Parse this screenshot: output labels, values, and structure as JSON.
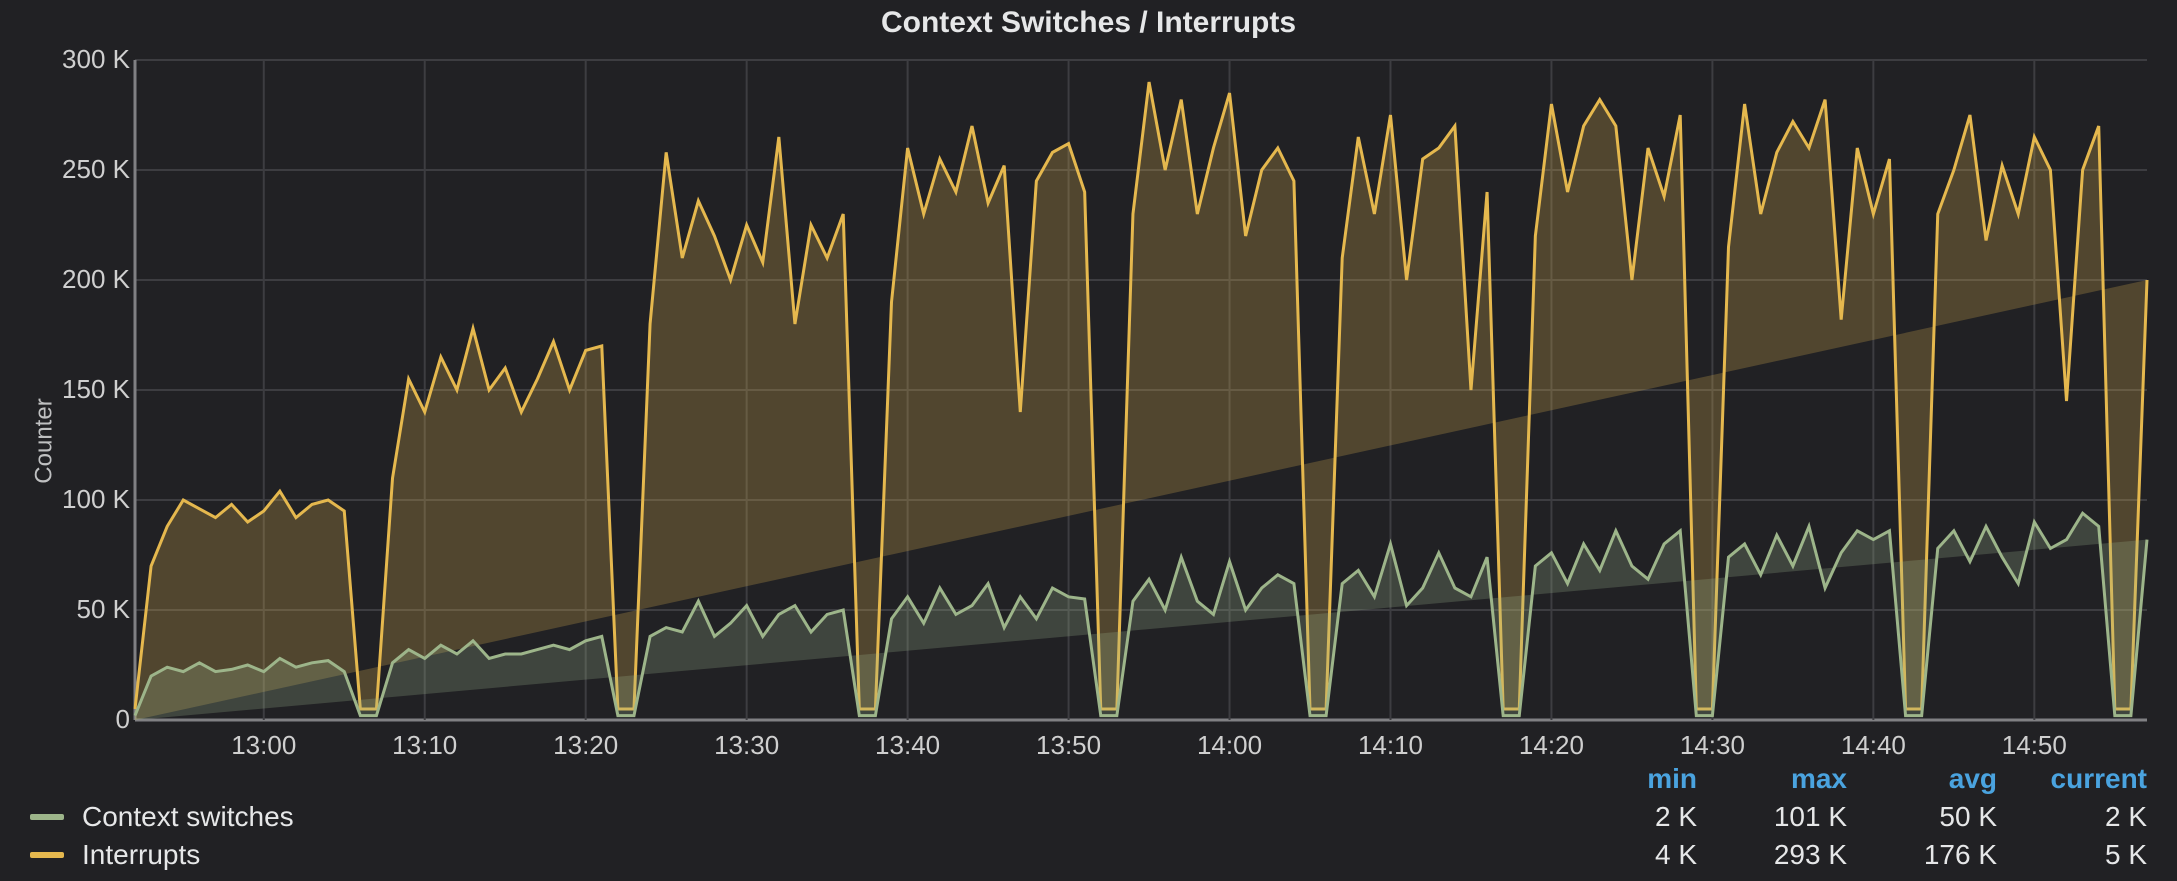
{
  "title": "Context Switches / Interrupts",
  "ylabel": "Counter",
  "colors": {
    "cs": "#9db58a",
    "int": "#e5b84e"
  },
  "legend_header": [
    "min",
    "max",
    "avg",
    "current"
  ],
  "series": [
    {
      "key": "cs",
      "name": "Context switches",
      "stats": [
        "2 K",
        "101 K",
        "50 K",
        "2 K"
      ]
    },
    {
      "key": "int",
      "name": "Interrupts",
      "stats": [
        "4 K",
        "293 K",
        "176 K",
        "5 K"
      ]
    }
  ],
  "y_ticks": [
    0,
    50,
    100,
    150,
    200,
    250,
    300
  ],
  "y_tick_labels": [
    "0",
    "50 K",
    "100 K",
    "150 K",
    "200 K",
    "250 K",
    "300 K"
  ],
  "x_ticks": [
    780,
    785,
    790,
    795,
    800,
    805,
    810,
    815,
    820,
    825,
    830,
    835
  ],
  "x_tick_labels": [
    "13:00",
    "13:10",
    "13:20",
    "13:30",
    "13:40",
    "13:50",
    "14:00",
    "14:10",
    "14:20",
    "14:30",
    "14:40",
    "14:50"
  ],
  "chart_data": {
    "type": "line",
    "title": "Context Switches / Interrupts",
    "xlabel": "",
    "ylabel": "Counter",
    "ylim": [
      0,
      300
    ],
    "x_unit": "minutes_since_midnight",
    "x": [
      776,
      776.5,
      777,
      777.5,
      778,
      778.5,
      779,
      779.5,
      780,
      780.5,
      781,
      781.5,
      782,
      782.5,
      783,
      783.5,
      784,
      784.5,
      785,
      785.5,
      786,
      786.5,
      787,
      787.5,
      788,
      788.5,
      789,
      789.5,
      790,
      790.5,
      791,
      791.5,
      792,
      792.5,
      793,
      793.5,
      794,
      794.5,
      795,
      795.5,
      796,
      796.5,
      797,
      797.5,
      798,
      798.5,
      799,
      799.5,
      800,
      800.5,
      801,
      801.5,
      802,
      802.5,
      803,
      803.5,
      804,
      804.5,
      805,
      805.5,
      806,
      806.5,
      807,
      807.5,
      808,
      808.5,
      809,
      809.5,
      810,
      810.5,
      811,
      811.5,
      812,
      812.5,
      813,
      813.5,
      814,
      814.5,
      815,
      815.5,
      816,
      816.5,
      817,
      817.5,
      818,
      818.5,
      819,
      819.5,
      820,
      820.5,
      821,
      821.5,
      822,
      822.5,
      823,
      823.5,
      824,
      824.5,
      825,
      825.5,
      826,
      826.5,
      827,
      827.5,
      828,
      828.5,
      829,
      829.5,
      830,
      830.5,
      831,
      831.5,
      832,
      832.5,
      833,
      833.5,
      834,
      834.5,
      835,
      835.5,
      836,
      836.5,
      837,
      837.5,
      838,
      838.5
    ],
    "series": [
      {
        "name": "Interrupts",
        "values": [
          5,
          70,
          88,
          100,
          96,
          92,
          98,
          90,
          95,
          104,
          92,
          98,
          100,
          95,
          5,
          5,
          110,
          155,
          140,
          165,
          150,
          178,
          150,
          160,
          140,
          155,
          172,
          150,
          168,
          170,
          5,
          5,
          180,
          258,
          210,
          236,
          220,
          200,
          225,
          208,
          265,
          180,
          225,
          210,
          230,
          5,
          5,
          190,
          260,
          230,
          255,
          240,
          270,
          235,
          252,
          140,
          245,
          258,
          262,
          240,
          5,
          5,
          230,
          290,
          250,
          282,
          230,
          260,
          285,
          220,
          250,
          260,
          245,
          5,
          5,
          210,
          265,
          230,
          275,
          200,
          255,
          260,
          270,
          150,
          240,
          5,
          5,
          220,
          280,
          240,
          270,
          282,
          270,
          200,
          260,
          238,
          275,
          5,
          5,
          215,
          280,
          230,
          258,
          272,
          260,
          282,
          182,
          260,
          230,
          255,
          5,
          5,
          230,
          250,
          275,
          218,
          252,
          230,
          265,
          250,
          145,
          250,
          270,
          5,
          5,
          200,
          265,
          225,
          258,
          244,
          200,
          248,
          262,
          240,
          5,
          5,
          235,
          260,
          222,
          240,
          263,
          210,
          250,
          252,
          232,
          5,
          5,
          200,
          255,
          172,
          258,
          230,
          262,
          212,
          244,
          140,
          262,
          240
        ],
        "color": "#e5b84e"
      },
      {
        "name": "Context switches",
        "values": [
          2,
          20,
          24,
          22,
          26,
          22,
          23,
          25,
          22,
          28,
          24,
          26,
          27,
          22,
          2,
          2,
          26,
          32,
          28,
          34,
          30,
          36,
          28,
          30,
          30,
          32,
          34,
          32,
          36,
          38,
          2,
          2,
          38,
          42,
          40,
          54,
          38,
          44,
          52,
          38,
          48,
          52,
          40,
          48,
          50,
          2,
          2,
          46,
          56,
          44,
          60,
          48,
          52,
          62,
          42,
          56,
          46,
          60,
          56,
          55,
          2,
          2,
          54,
          64,
          50,
          74,
          54,
          48,
          72,
          50,
          60,
          66,
          62,
          2,
          2,
          62,
          68,
          56,
          80,
          52,
          60,
          76,
          60,
          56,
          74,
          2,
          2,
          70,
          76,
          62,
          80,
          68,
          86,
          70,
          64,
          80,
          86,
          2,
          2,
          74,
          80,
          66,
          84,
          70,
          88,
          60,
          76,
          86,
          82,
          86,
          2,
          2,
          78,
          86,
          72,
          88,
          74,
          62,
          90,
          78,
          82,
          94,
          88,
          2,
          2,
          82,
          92,
          78,
          94,
          80,
          74,
          96,
          82,
          90,
          2,
          2,
          88,
          94,
          72,
          101,
          78,
          80,
          94,
          82,
          96,
          2,
          2,
          84,
          96,
          78,
          98,
          80,
          86,
          100,
          84,
          72,
          90,
          94
        ],
        "color": "#9db58a"
      }
    ],
    "legend": [
      "Context switches",
      "Interrupts"
    ],
    "stats": {
      "Context switches": {
        "min": "2 K",
        "max": "101 K",
        "avg": "50 K",
        "current": "2 K"
      },
      "Interrupts": {
        "min": "4 K",
        "max": "293 K",
        "avg": "176 K",
        "current": "5 K"
      }
    }
  }
}
